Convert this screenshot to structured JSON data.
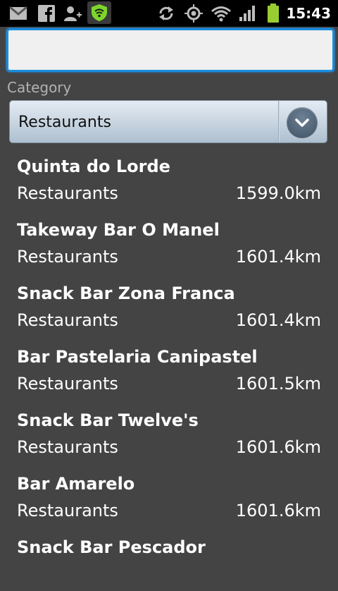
{
  "status_bar": {
    "time": "15:43",
    "icons": [
      "gmail-icon",
      "facebook-icon",
      "add-contact-icon",
      "wifi-shield-icon",
      "sync-icon",
      "gps-icon",
      "wifi-icon",
      "signal-icon",
      "battery-icon"
    ],
    "colors": {
      "background": "#000000",
      "shield": "#7cd62b",
      "battery": "#9acd32"
    }
  },
  "search": {
    "value": "",
    "placeholder": ""
  },
  "filter": {
    "label": "Category",
    "selected": "Restaurants",
    "dropdown_icon": "chevron-down-icon"
  },
  "results": [
    {
      "name": "Quinta do Lorde",
      "category": "Restaurants",
      "distance": "1599.0km"
    },
    {
      "name": "Takeway Bar O Manel",
      "category": "Restaurants",
      "distance": "1601.4km"
    },
    {
      "name": "Snack Bar Zona Franca",
      "category": "Restaurants",
      "distance": "1601.4km"
    },
    {
      "name": "Bar Pastelaria Canipastel",
      "category": "Restaurants",
      "distance": "1601.5km"
    },
    {
      "name": "Snack Bar Twelve's",
      "category": "Restaurants",
      "distance": "1601.6km"
    },
    {
      "name": "Bar Amarelo",
      "category": "Restaurants",
      "distance": "1601.6km"
    },
    {
      "name": "Snack Bar Pescador",
      "category": "",
      "distance": ""
    }
  ],
  "colors": {
    "background": "#444444",
    "focus_border": "#1a8ee0",
    "label_text": "#b3b3b3"
  }
}
